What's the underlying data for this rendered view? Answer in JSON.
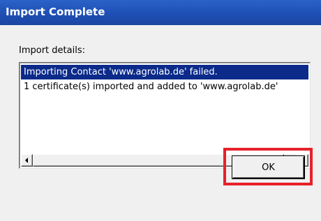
{
  "window": {
    "title": "Import Complete"
  },
  "details": {
    "label": "Import details:",
    "items": [
      "Importing Contact 'www.agrolab.de' failed.",
      "1 certificate(s) imported and added to 'www.agrolab.de'"
    ],
    "selected_index": 0
  },
  "buttons": {
    "ok_label": "OK"
  },
  "colors": {
    "titlebar": "#1f4fb4",
    "selection": "#0b2a8a",
    "highlight_box": "#e8202a"
  }
}
